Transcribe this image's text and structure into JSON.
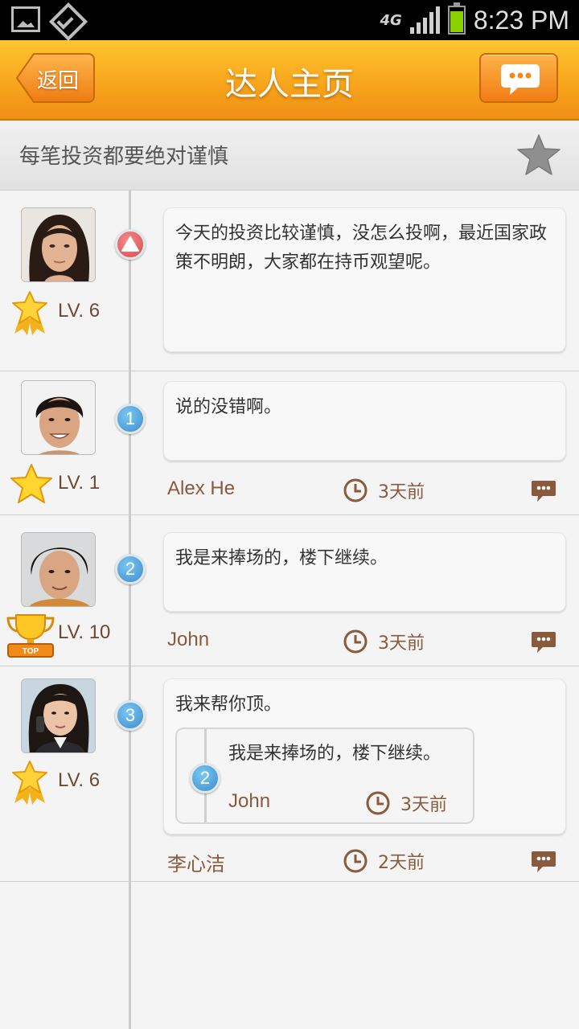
{
  "status_bar": {
    "network": "4G",
    "time": "8:23 PM"
  },
  "header": {
    "back_label": "返回",
    "title": "达人主页",
    "icons": {
      "back": "back-arrow-icon",
      "chat": "chat-bubble-icon"
    }
  },
  "subheader": {
    "motto": "每笔投资都要绝对谨慎",
    "favorite_icon": "star-icon"
  },
  "posts": [
    {
      "badge": "▲",
      "level": "LV. 6",
      "level_icon": "star-medal-icon",
      "text": "今天的投资比较谨慎，没怎么投啊，最近国家政策不明朗，大家都在持币观望呢。"
    },
    {
      "badge": "1",
      "level": "LV. 1",
      "level_icon": "gold-star-icon",
      "text": "说的没错啊。",
      "author": "Alex He",
      "time": "3天前"
    },
    {
      "badge": "2",
      "level": "LV. 10",
      "level_icon": "top-trophy-icon",
      "text": "我是来捧场的，楼下继续。",
      "author": "John",
      "time": "3天前"
    },
    {
      "badge": "3",
      "level": "LV. 6",
      "level_icon": "star-medal-icon",
      "text": "我来帮你顶。",
      "author": "李心洁",
      "time": "2天前",
      "quote": {
        "badge": "2",
        "text": "我是来捧场的，楼下继续。",
        "author": "John",
        "time": "3天前"
      }
    }
  ],
  "colors": {
    "header_orange": "#f7a31b",
    "meta_brown": "#8a5a3c",
    "badge_blue": "#3d8ccb",
    "top_badge_red": "#d94a4a"
  }
}
